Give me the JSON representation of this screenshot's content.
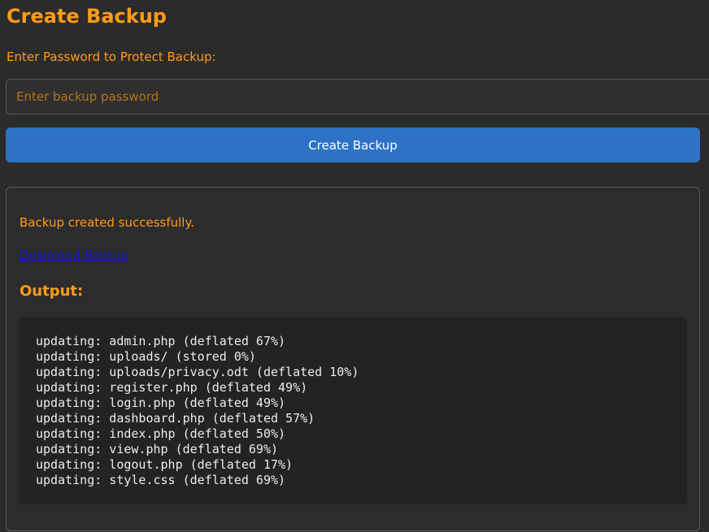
{
  "page": {
    "title": "Create Backup"
  },
  "form": {
    "password_label": "Enter Password to Protect Backup:",
    "password_placeholder": "Enter backup password",
    "password_value": "",
    "submit_label": "Create Backup"
  },
  "result": {
    "message": "Backup created successfully.",
    "download_label": "Download Backup",
    "output_heading": "Output:",
    "output_lines": [
      "updating: admin.php (deflated 67%)",
      "updating: uploads/ (stored 0%)",
      "updating: uploads/privacy.odt (deflated 10%)",
      "updating: register.php (deflated 49%)",
      "updating: login.php (deflated 49%)",
      "updating: dashboard.php (deflated 57%)",
      "updating: index.php (deflated 50%)",
      "updating: view.php (deflated 69%)",
      "updating: logout.php (deflated 17%)",
      "updating: style.css (deflated 69%)"
    ]
  },
  "colors": {
    "background": "#2b2b2b",
    "accent_orange": "#ff9c1a",
    "button_blue": "#2d72c4",
    "link_blue": "#1a12c9",
    "code_background": "#232323"
  }
}
